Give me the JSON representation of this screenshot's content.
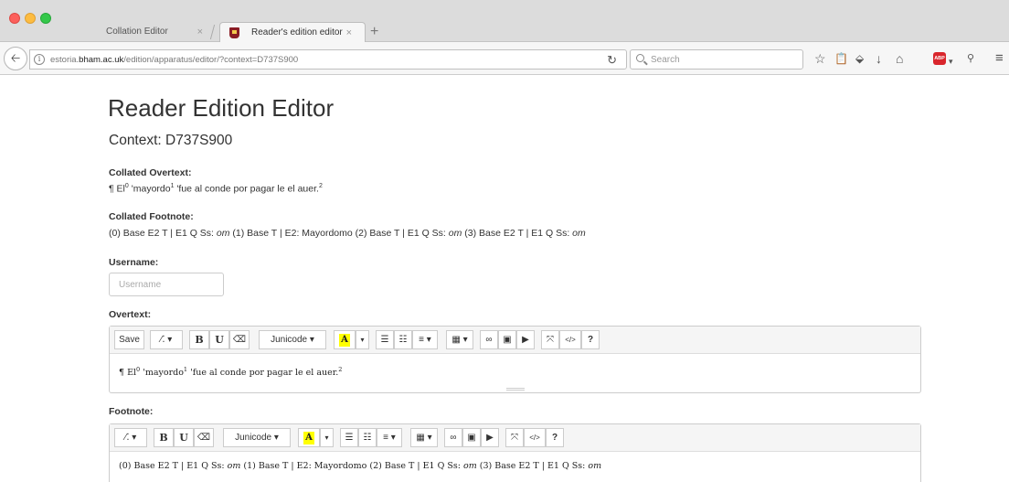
{
  "browser": {
    "tabs": [
      {
        "label": "Collation Editor",
        "close": "×"
      },
      {
        "label": "Reader's edition editor",
        "close": "×"
      }
    ],
    "new_tab": "+",
    "url_prefix": "estoria.",
    "url_domain": "bham.ac.uk",
    "url_path": "/edition/apparatus/editor/?context=D737S900",
    "search_placeholder": "Search",
    "toolbar_icons": [
      "star-icon",
      "reading-list-icon",
      "pocket-icon",
      "download-icon",
      "home-icon",
      "adblock-icon",
      "extension-icon",
      "menu-icon"
    ],
    "adblock_text": "ABP"
  },
  "page": {
    "title": "Reader Edition Editor",
    "context": "Context: D737S900",
    "collated_overtext_label": "Collated Overtext:",
    "collated_overtext": {
      "pilcrow": "¶ El",
      "s0": "0",
      "w1": " 'mayordo",
      "s1": "1",
      "w2": " 'fue al conde por pagar le el auer.",
      "s2": "2"
    },
    "collated_footnote_label": "Collated Footnote:",
    "collated_footnote": [
      {
        "t": "(0) Base E2 T | E1 Q Ss: "
      },
      {
        "i": "om"
      },
      {
        "t": " (1) Base T | E2: Mayordomo (2) Base T | E1 Q Ss: "
      },
      {
        "i": "om"
      },
      {
        "t": " (3) Base E2 T | E1 Q Ss: "
      },
      {
        "i": "om"
      }
    ],
    "username_label": "Username:",
    "username_placeholder": "Username",
    "overtext_label": "Overtext:",
    "footnote_label": "Footnote:"
  },
  "overtext_editor": {
    "toolbar": {
      "save": "Save",
      "magic": "⁄⁚ ▾",
      "bold": "B",
      "underline": "U",
      "eraser": "⌫",
      "font": "Junicode ▾",
      "color": "A",
      "color_caret": "▾",
      "ul": "☰",
      "ol": "☷",
      "align": "≡ ▾",
      "table": "▦ ▾",
      "link": "∞",
      "image": "▣",
      "video": "▶",
      "fullscreen": "⤧",
      "code": "</>",
      "help": "?"
    },
    "content": {
      "pilcrow": "¶ El",
      "s0": "0",
      "w1": " 'mayordo",
      "s1": "1",
      "w2": " 'fue al conde por pagar le el auer.",
      "s2": "2"
    }
  },
  "footnote_editor": {
    "toolbar": {
      "magic": "⁄⁚ ▾",
      "bold": "B",
      "underline": "U",
      "eraser": "⌫",
      "font": "Junicode ▾",
      "color": "A",
      "color_caret": "▾",
      "ul": "☰",
      "ol": "☷",
      "align": "≡ ▾",
      "table": "▦ ▾",
      "link": "∞",
      "image": "▣",
      "video": "▶",
      "fullscreen": "⤧",
      "code": "</>",
      "help": "?"
    },
    "content": [
      {
        "t": "(0) Base E2 T | E1 Q Ss: "
      },
      {
        "i": "om"
      },
      {
        "t": " (1) Base T | E2: Mayordomo (2) Base T | E1 Q Ss: "
      },
      {
        "i": "om"
      },
      {
        "t": " (3) Base E2 T | E1 Q Ss: "
      },
      {
        "i": "om"
      }
    ]
  }
}
